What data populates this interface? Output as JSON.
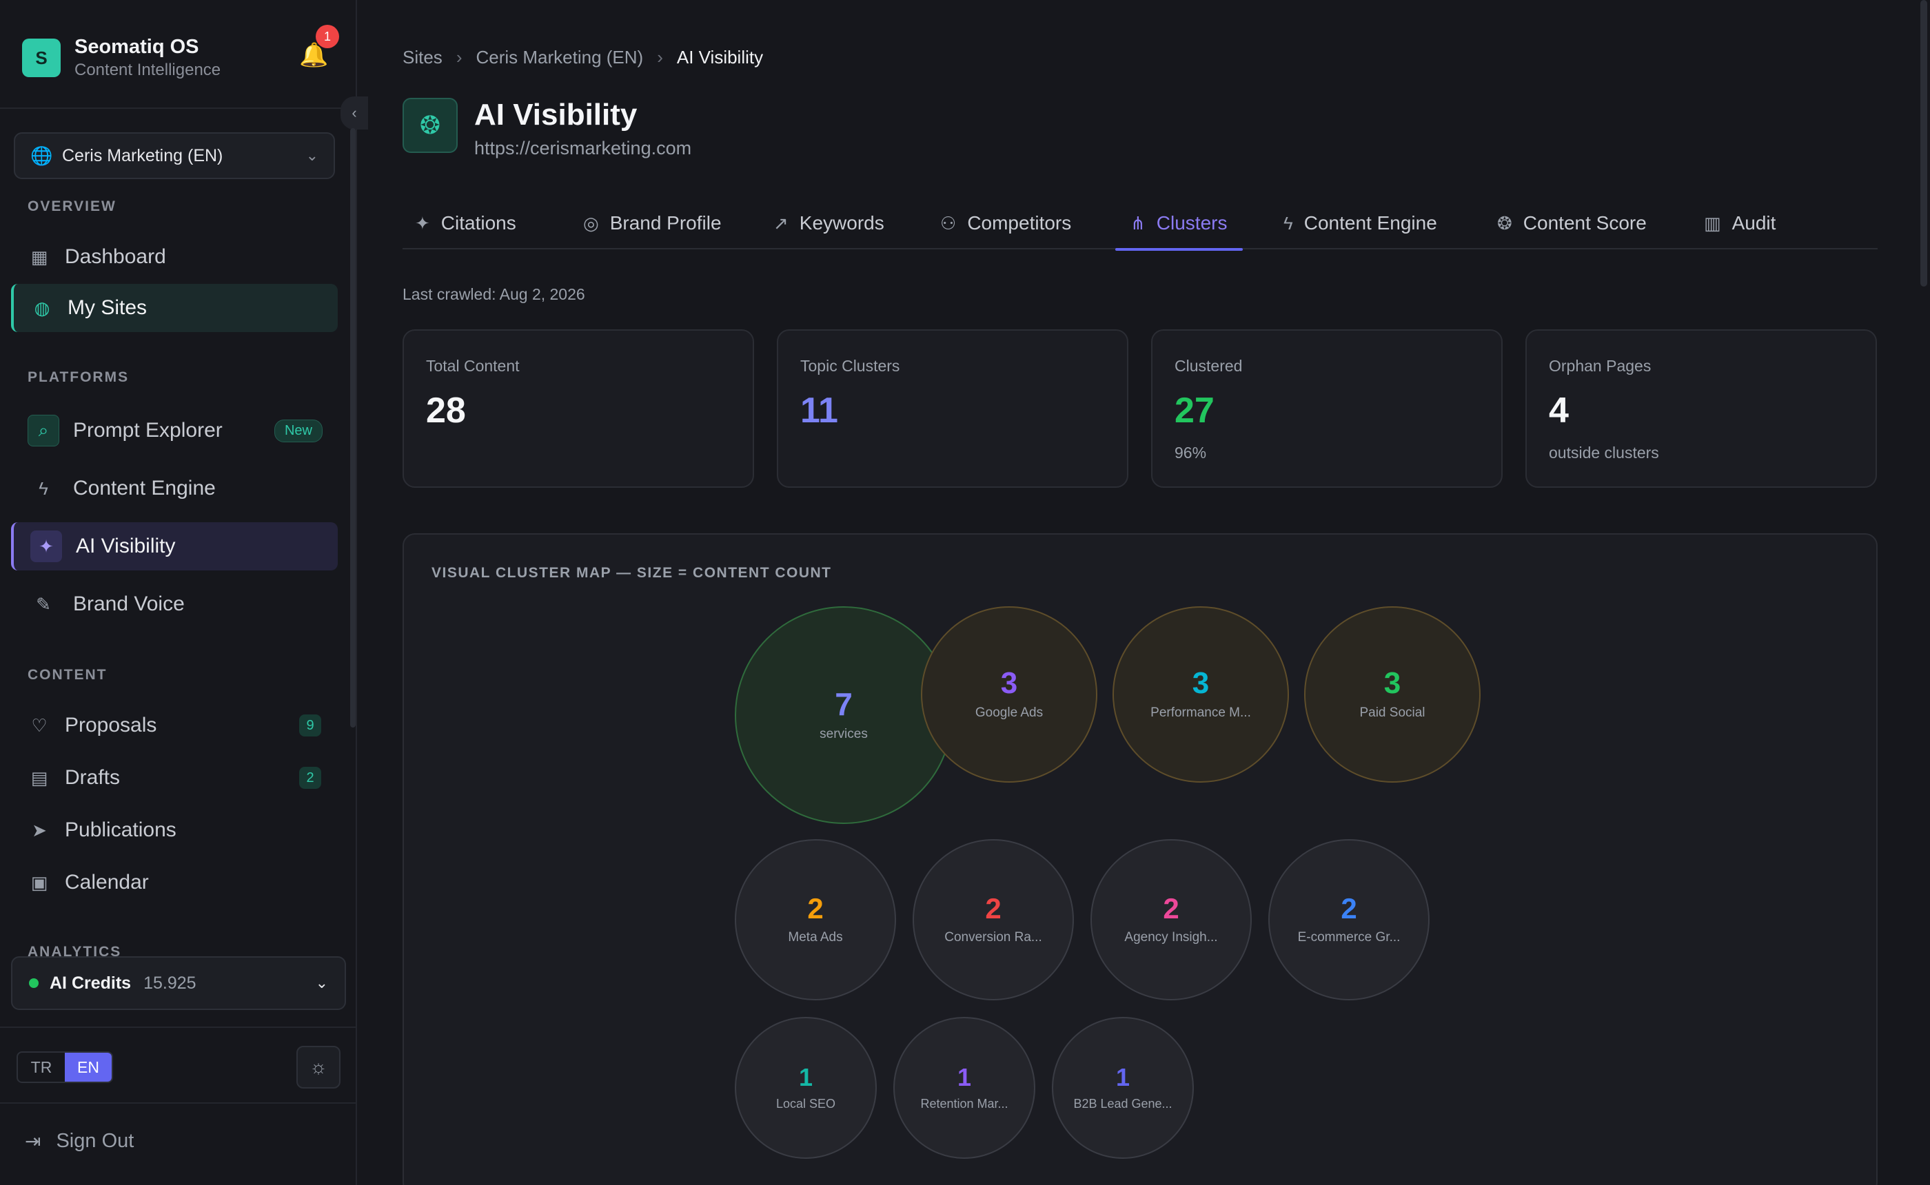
{
  "app": {
    "name": "Seomatiq OS",
    "subtitle": "Content Intelligence",
    "logo_letter": "S",
    "notification_count": "1"
  },
  "site_selector": {
    "value": "Ceris Marketing (EN)"
  },
  "sidebar": {
    "overview_label": "OVERVIEW",
    "overview": [
      {
        "label": "Dashboard",
        "icon": "grid-icon"
      },
      {
        "label": "My Sites",
        "icon": "globe-icon"
      }
    ],
    "platforms_label": "PLATFORMS",
    "platforms": [
      {
        "label": "Prompt Explorer",
        "icon": "search-sparkle-icon",
        "badge": "New"
      },
      {
        "label": "Content Engine",
        "icon": "bolt-icon"
      },
      {
        "label": "AI Visibility",
        "icon": "sparkles-icon"
      },
      {
        "label": "Brand Voice",
        "icon": "feather-icon"
      }
    ],
    "content_label": "CONTENT",
    "content": [
      {
        "label": "Proposals",
        "icon": "lightbulb-icon",
        "count": "9"
      },
      {
        "label": "Drafts",
        "icon": "document-icon",
        "count": "2"
      },
      {
        "label": "Publications",
        "icon": "send-icon"
      },
      {
        "label": "Calendar",
        "icon": "calendar-icon"
      }
    ],
    "analytics_label": "ANALYTICS",
    "credits": {
      "label": "AI Credits",
      "value": "15.925"
    },
    "lang": {
      "tr": "TR",
      "en": "EN",
      "selected": "EN"
    },
    "sign_out": "Sign Out"
  },
  "breadcrumb": [
    "Sites",
    "Ceris Marketing (EN)",
    "AI Visibility"
  ],
  "page": {
    "title": "AI Visibility",
    "url": "https://cerismarketing.com"
  },
  "tabs": [
    {
      "label": "Citations",
      "icon": "sparkles-icon"
    },
    {
      "label": "Brand Profile",
      "icon": "fingerprint-icon"
    },
    {
      "label": "Keywords",
      "icon": "trending-up-icon"
    },
    {
      "label": "Competitors",
      "icon": "users-icon"
    },
    {
      "label": "Clusters",
      "icon": "network-icon",
      "active": true
    },
    {
      "label": "Content Engine",
      "icon": "bolt-icon"
    },
    {
      "label": "Content Score",
      "icon": "brain-icon"
    },
    {
      "label": "Audit",
      "icon": "file-check-icon"
    }
  ],
  "last_crawled": "Last crawled: Aug 2, 2026",
  "stats": [
    {
      "label": "Total Content",
      "value": "28",
      "sub": "",
      "color": "#f5f6f8"
    },
    {
      "label": "Topic Clusters",
      "value": "11",
      "sub": "",
      "color": "#7c83f5"
    },
    {
      "label": "Clustered",
      "value": "27",
      "sub": "96%",
      "color": "#22c55e"
    },
    {
      "label": "Orphan Pages",
      "value": "4",
      "sub": "outside clusters",
      "color": "#f5f6f8"
    }
  ],
  "cluster_map": {
    "title": "VISUAL CLUSTER MAP — SIZE = CONTENT COUNT",
    "clusters": [
      {
        "count": "7",
        "label": "services",
        "color": "#7c83f5",
        "tone": "green"
      },
      {
        "count": "3",
        "label": "Google Ads",
        "color": "#8b5cf6",
        "tone": "amber"
      },
      {
        "count": "3",
        "label": "Performance M...",
        "color": "#06b6d4",
        "tone": "amber"
      },
      {
        "count": "3",
        "label": "Paid Social",
        "color": "#22c55e",
        "tone": "amber"
      },
      {
        "count": "2",
        "label": "Meta Ads",
        "color": "#f59e0b",
        "tone": "neutral"
      },
      {
        "count": "2",
        "label": "Conversion Ra...",
        "color": "#ef4444",
        "tone": "neutral"
      },
      {
        "count": "2",
        "label": "Agency Insigh...",
        "color": "#ec4899",
        "tone": "neutral"
      },
      {
        "count": "2",
        "label": "E-commerce Gr...",
        "color": "#3b82f6",
        "tone": "neutral"
      },
      {
        "count": "1",
        "label": "Local SEO",
        "color": "#14b8a6",
        "tone": "neutral"
      },
      {
        "count": "1",
        "label": "Retention Mar...",
        "color": "#8b5cf6",
        "tone": "neutral"
      },
      {
        "count": "1",
        "label": "B2B Lead Gene...",
        "color": "#6366f1",
        "tone": "neutral"
      }
    ]
  }
}
